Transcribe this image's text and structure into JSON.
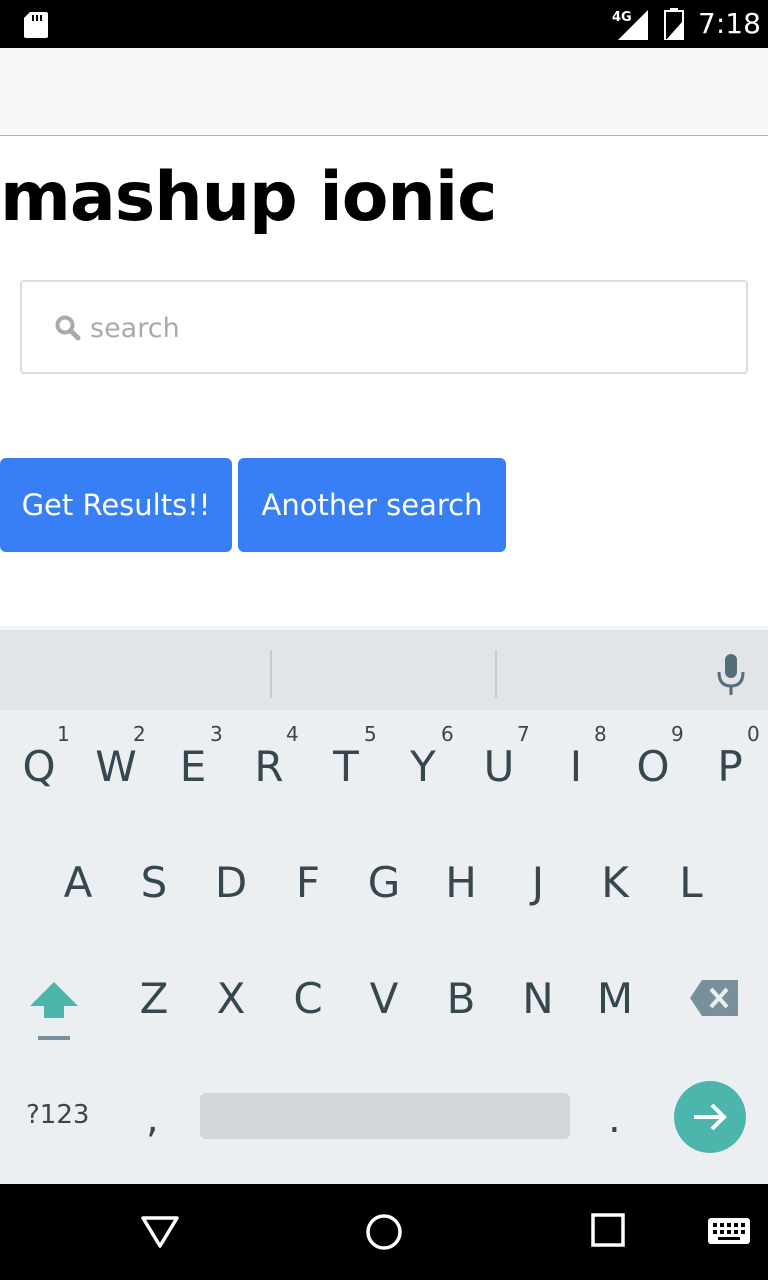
{
  "status_bar": {
    "network": "4G",
    "time": "7:18",
    "icons": [
      "sd-card-icon",
      "signal-icon",
      "battery-icon"
    ]
  },
  "page": {
    "title": "mashup ionic",
    "search": {
      "placeholder": "search",
      "value": "",
      "icon": "search-icon"
    },
    "buttons": {
      "get_results": "Get Results!!",
      "another_search": "Another search"
    },
    "colors": {
      "button": "#387ef5",
      "header_bg": "#f8f8f8"
    }
  },
  "keyboard": {
    "row1": [
      "Q",
      "W",
      "E",
      "R",
      "T",
      "Y",
      "U",
      "I",
      "O",
      "P"
    ],
    "row1_hints": [
      "1",
      "2",
      "3",
      "4",
      "5",
      "6",
      "7",
      "8",
      "9",
      "0"
    ],
    "row2": [
      "A",
      "S",
      "D",
      "F",
      "G",
      "H",
      "J",
      "K",
      "L"
    ],
    "row3": [
      "Z",
      "X",
      "C",
      "V",
      "B",
      "N",
      "M"
    ],
    "symbols_key": "?123",
    "comma_key": ",",
    "period_key": ".",
    "enter_color": "#4db6ac"
  },
  "nav_bar": {
    "icons": [
      "back-icon",
      "home-icon",
      "recents-icon",
      "keyboard-icon"
    ]
  }
}
